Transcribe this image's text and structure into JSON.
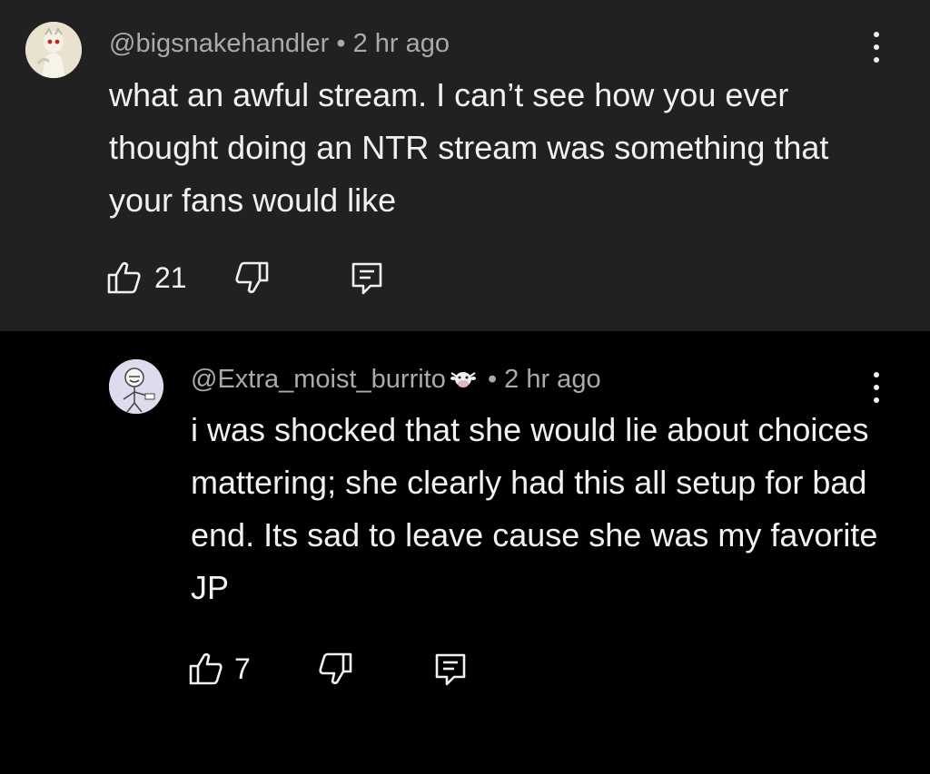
{
  "comments": [
    {
      "handle": "@bigsnakehandler",
      "time": "2 hr ago",
      "separator": "•",
      "text": "what an awful stream. I can’t see how you ever thought doing an NTR stream was something that your fans would like",
      "likes": "21",
      "avatar_icon": "avatar-image"
    },
    {
      "handle": "@Extra_moist_burrito",
      "badge_icon": "cow-member-badge-icon",
      "time": "2 hr ago",
      "separator": "•",
      "text": "i was shocked that she would lie about choices mattering; she clearly had this all setup for bad end. Its sad to leave cause she was my favorite JP",
      "likes": "7",
      "avatar_icon": "avatar-image"
    }
  ],
  "colors": {
    "parent_bg": "#212121",
    "reply_bg": "#000000",
    "text": "#f1f1f1",
    "meta": "#aaaaaa"
  },
  "icons": {
    "like": "thumbs-up-icon",
    "dislike": "thumbs-down-icon",
    "reply": "reply-comment-icon",
    "menu": "more-vert-icon"
  }
}
